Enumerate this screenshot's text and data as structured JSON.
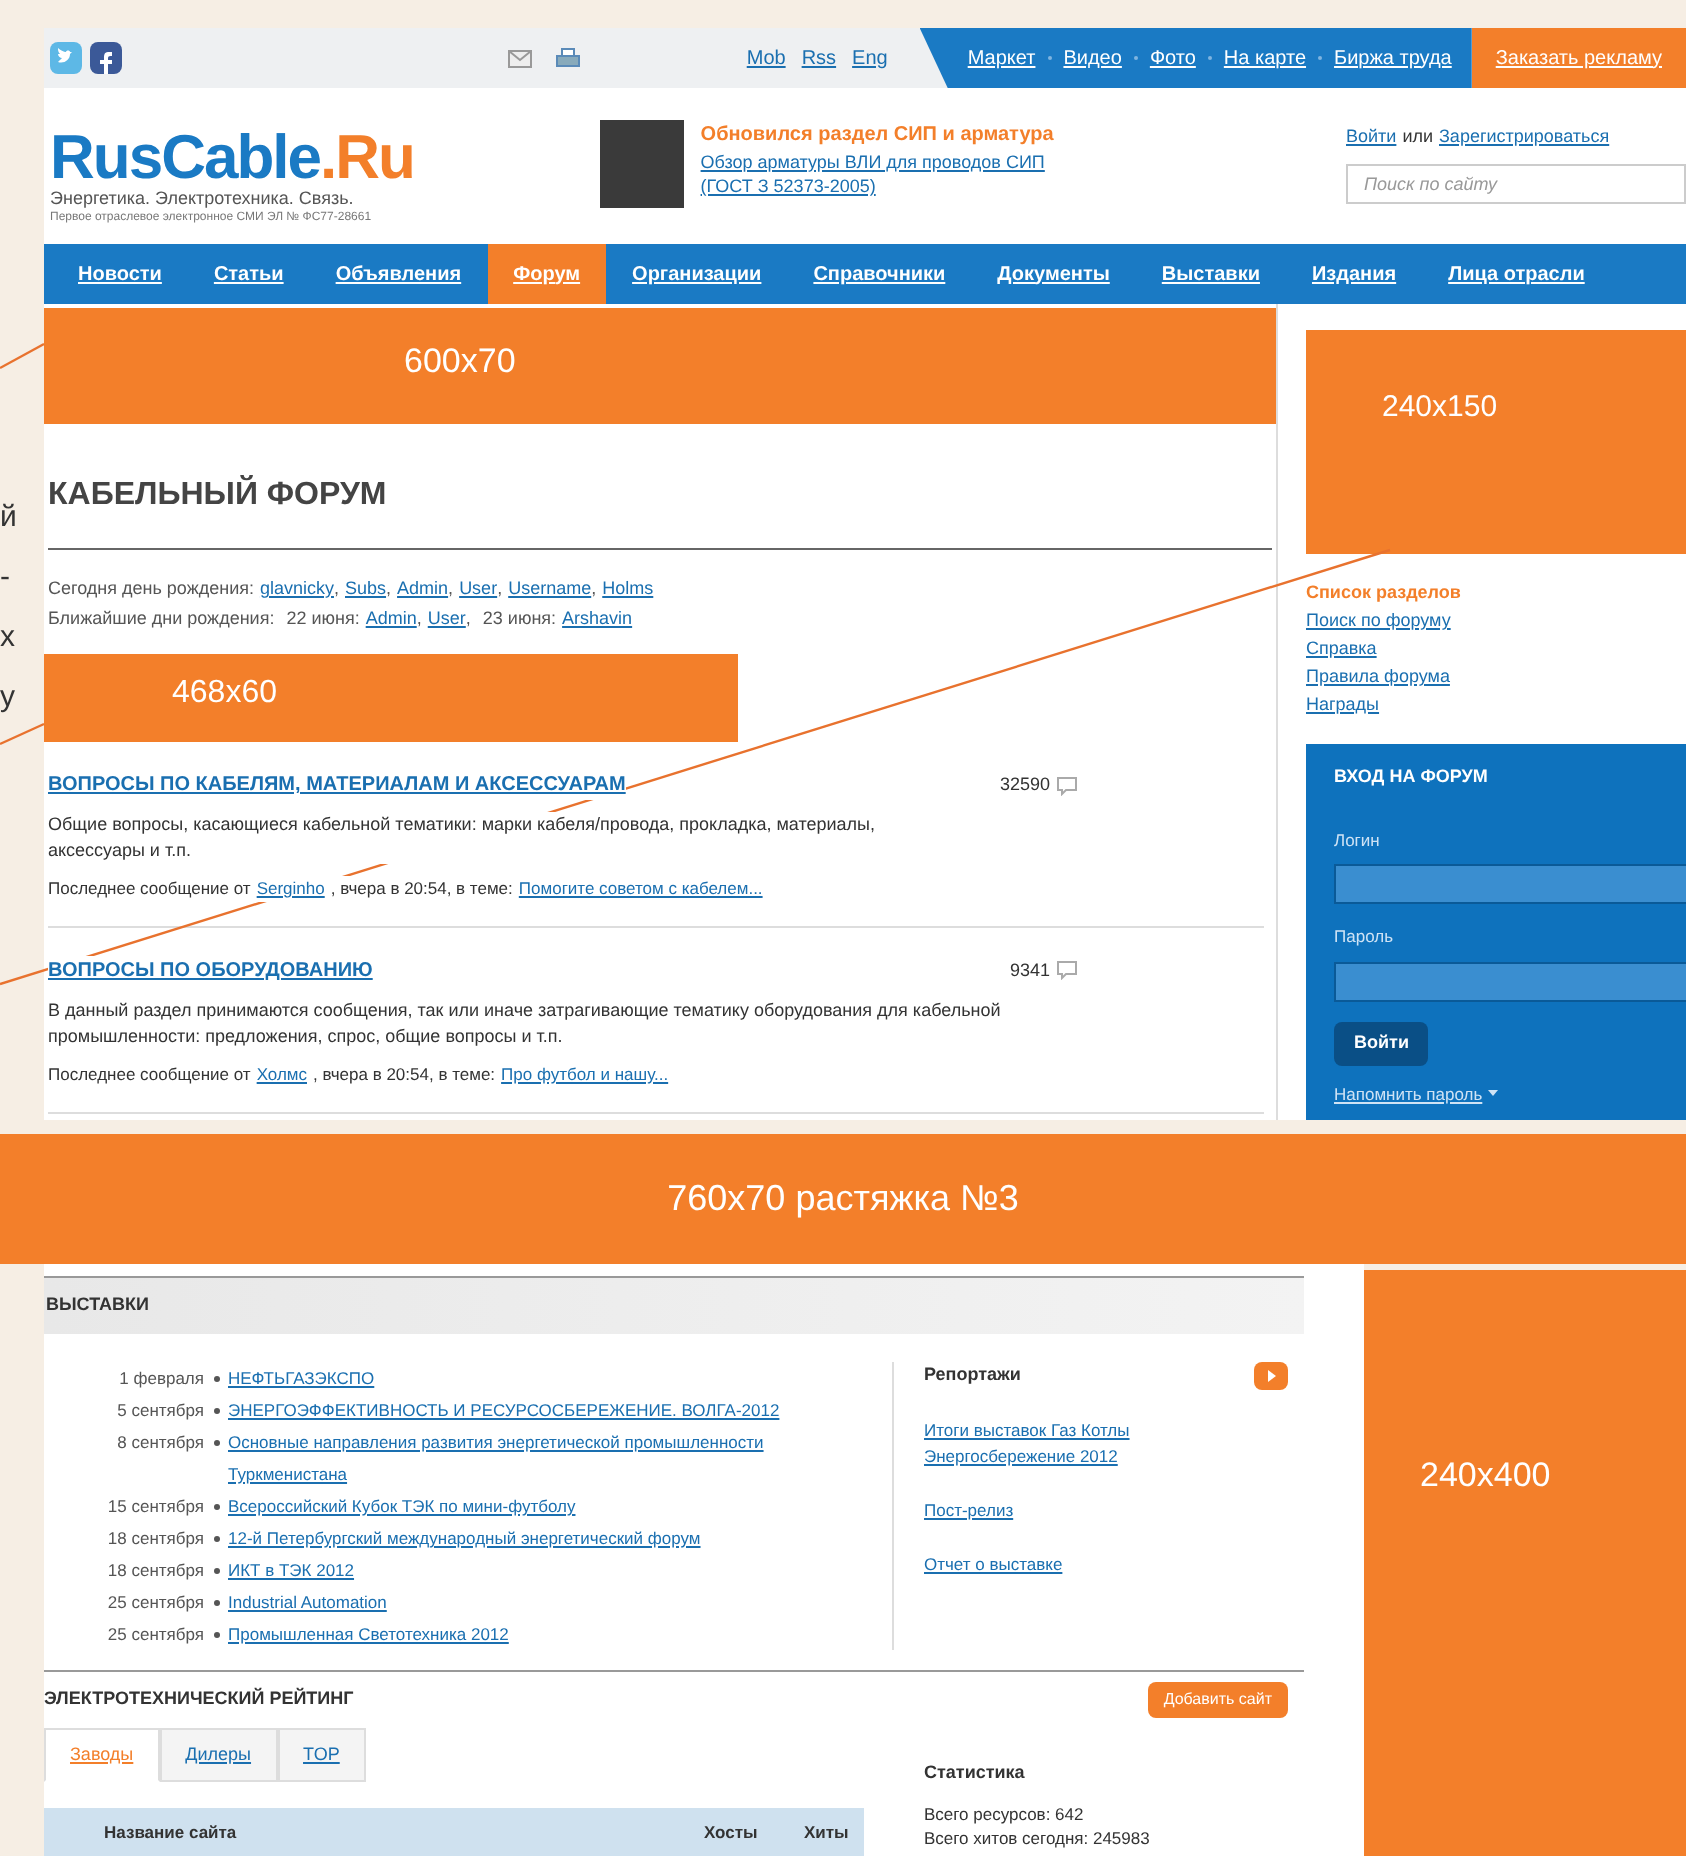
{
  "margin_fragments": [
    "й",
    "-",
    "х",
    "у"
  ],
  "top_bar": {
    "social": [
      {
        "kind": "twitter"
      },
      {
        "kind": "facebook"
      }
    ],
    "tools": [
      {
        "kind": "mail"
      },
      {
        "kind": "print"
      }
    ],
    "versions": [
      "Mob",
      "Rss",
      "Eng"
    ],
    "services": [
      "Маркет",
      "Видео",
      "Фото",
      "На карте",
      "Биржа труда"
    ],
    "order_button": "Заказать рекламу"
  },
  "header": {
    "logo_main": "RusCable",
    "logo_suffix": ".Ru",
    "tagline": "Энергетика. Электротехника. Связь.",
    "registration": "Первое отраслевое электронное СМИ ЭЛ № ФС77-28661",
    "news": {
      "title": "Обновился раздел СИП и арматура",
      "link": "Обзор арматуры ВЛИ для проводов СИП (ГОСТ З 52373-2005)"
    },
    "auth": {
      "login": "Войти",
      "or": "или",
      "register": "Зарегистрироваться"
    },
    "search": {
      "placeholder": "Поиск по сайту"
    }
  },
  "nav": [
    {
      "label": "Новости",
      "selected": false
    },
    {
      "label": "Статьи",
      "selected": false
    },
    {
      "label": "Объявления",
      "selected": false
    },
    {
      "label": "Форум",
      "selected": true
    },
    {
      "label": "Организации",
      "selected": false
    },
    {
      "label": "Справочники",
      "selected": false
    },
    {
      "label": "Документы",
      "selected": false
    },
    {
      "label": "Выставки",
      "selected": false
    },
    {
      "label": "Издания",
      "selected": false
    },
    {
      "label": "Лица отрасли",
      "selected": false
    }
  ],
  "ads": {
    "top": "600x70",
    "side": "240x150",
    "inline": "468x60",
    "stretch": "760x70 растяжка №3",
    "tall": "240x400"
  },
  "forum": {
    "title": "КАБЕЛЬНЫЙ ФОРУМ",
    "birthdays_today": {
      "label": "Сегодня день рождения:",
      "separator": ",",
      "users": [
        "glavnicky",
        "Subs",
        "Admin",
        "User",
        "Username",
        "Holms"
      ]
    },
    "birthdays_upcoming": {
      "label": "Ближайшие дни рождения:",
      "groups": [
        {
          "date": "22 июня:",
          "users": [
            "Admin",
            "User"
          ]
        },
        {
          "date": "23 июня:",
          "users": [
            "Arshavin"
          ]
        }
      ]
    },
    "sections": [
      {
        "title": "ВОПРОСЫ ПО КАБЕЛЯМ, МАТЕРИАЛАМ И АКСЕССУАРАМ",
        "count": "32590",
        "description": "Общие вопросы, касающиеся кабельной тематики: марки кабеля/провода, прокладка, материалы, аксессуары и т.п.",
        "last_prefix": "Последнее сообщение от",
        "last_author": "Serginho",
        "last_time": ", вчера в 20:54, в теме:",
        "last_topic": "Помогите советом с кабелем..."
      },
      {
        "title": "ВОПРОСЫ ПО ОБОРУДОВАНИЮ",
        "count": "9341",
        "description": "В данный раздел принимаются сообщения, так или иначе затрагивающие тематику оборудования для кабельной промышленности: предложения, спрос, общие вопросы и т.п.",
        "last_prefix": "Последнее сообщение от",
        "last_author": "Холмс",
        "last_time": ", вчера в 20:54, в теме:",
        "last_topic": "Про футбол и нашу..."
      }
    ]
  },
  "sidebar": {
    "links": [
      {
        "label": "Список разделов",
        "selected": true
      },
      {
        "label": "Поиск по форуму",
        "selected": false
      },
      {
        "label": "Справка",
        "selected": false
      },
      {
        "label": "Правила форума",
        "selected": false
      },
      {
        "label": "Награды",
        "selected": false
      }
    ],
    "login_box": {
      "title": "ВХОД НА ФОРУМ",
      "login_label": "Логин",
      "password_label": "Пароль",
      "submit": "Войти",
      "remind": "Напомнить пароль"
    }
  },
  "exhibitions": {
    "title": "ВЫСТАВКИ",
    "items": [
      {
        "date": "1 февраля",
        "title": "НЕФТЬГАЗЭКСПО"
      },
      {
        "date": "5 сентября",
        "title": "ЭНЕРГОЭФФЕКТИВНОСТЬ И РЕСУРСОСБЕРЕЖЕНИЕ. ВОЛГА-2012"
      },
      {
        "date": "8 сентября",
        "title": "Основные направления развития энергетической промышленности Туркменистана"
      },
      {
        "date": "15 сентября",
        "title": "Всероссийский Кубок ТЭК по мини-футболу"
      },
      {
        "date": "18 сентября",
        "title": "12-й Петербургский международный энергетический форум"
      },
      {
        "date": "18 сентября",
        "title": "ИКТ в ТЭК 2012"
      },
      {
        "date": "25 сентября",
        "title": "Industrial Automation"
      },
      {
        "date": "25 сентября",
        "title": "Промышленная Светотехника 2012"
      }
    ],
    "reports": {
      "title": "Репортажи",
      "links": [
        "Итоги выставок Газ Котлы Энергосбережение 2012",
        "Пост-релиз",
        "Отчет о выставке"
      ]
    }
  },
  "rating": {
    "title": "ЭЛЕКТРОТЕХНИЧЕСКИЙ РЕЙТИНГ",
    "add_button": "Добавить сайт",
    "tabs": [
      {
        "label": "Заводы",
        "selected": true
      },
      {
        "label": "Дилеры",
        "selected": false
      },
      {
        "label": "TOP",
        "selected": false
      }
    ],
    "columns": [
      "Название сайта",
      "Хосты",
      "Хиты"
    ],
    "stats": {
      "title": "Статистика",
      "lines": [
        "Всего ресурсов: 642",
        "Всего хитов сегодня: 245983"
      ]
    }
  }
}
